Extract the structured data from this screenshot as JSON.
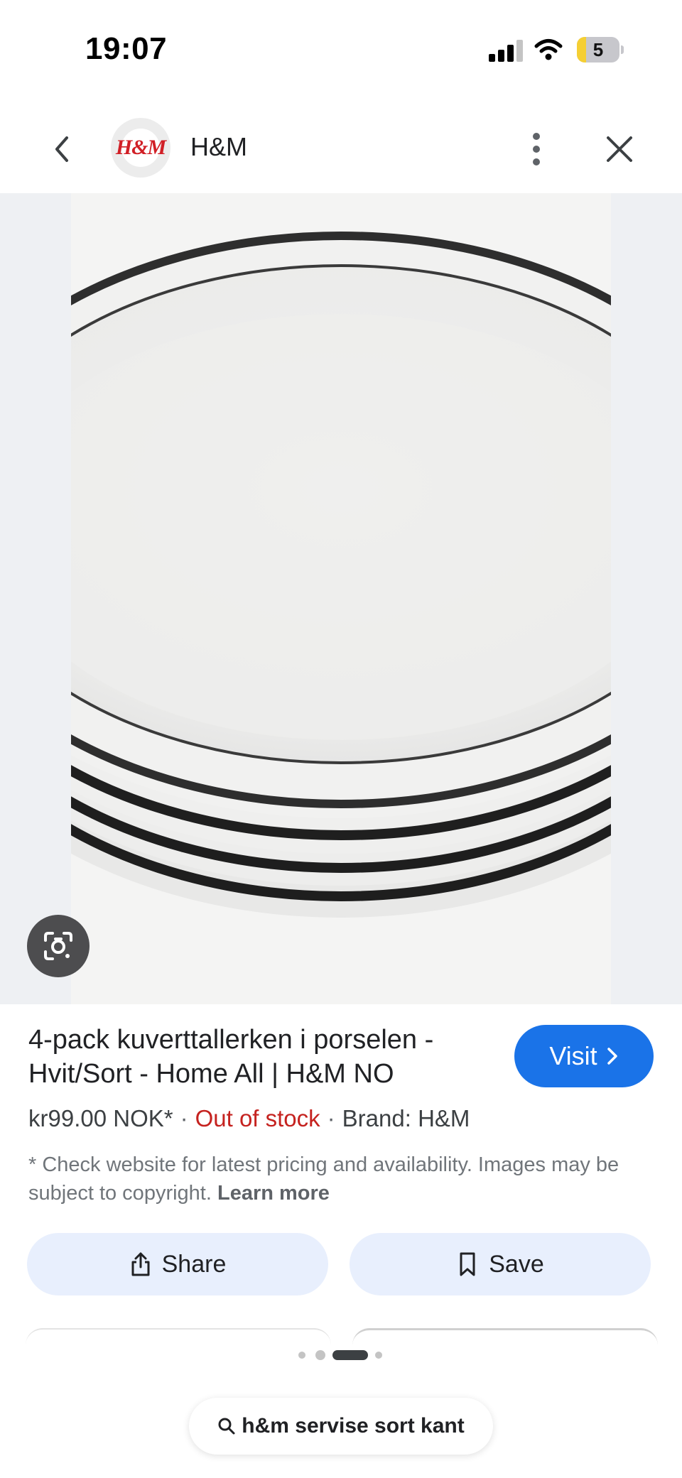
{
  "status_bar": {
    "time": "19:07",
    "battery": "5"
  },
  "header": {
    "brand_name": "H&M",
    "logo_text": "H&M"
  },
  "product": {
    "title": "4-pack kuverttallerken i porselen - Hvit/Sort - Home All | H&M NO",
    "price": "kr99.00 NOK*",
    "separator": "·",
    "stock_status": "Out of stock",
    "brand": "Brand: H&M",
    "disclaimer": "* Check website for latest pricing and availability. Images may be subject to copyright.",
    "learn_more": "Learn more"
  },
  "buttons": {
    "visit": "Visit",
    "share": "Share",
    "save": "Save"
  },
  "pager": {
    "count": 4,
    "active_index": 2
  },
  "search": {
    "query": "h&m servise sort kant"
  },
  "colors": {
    "accent": "#1a73e8",
    "out_of_stock": "#c5221f",
    "action_bg": "#e8effd",
    "brand_red": "#d11f26"
  },
  "icons": {
    "back": "chevron-left-icon",
    "more": "more-vertical-icon",
    "close": "close-icon",
    "lens": "google-lens-icon",
    "share": "share-icon",
    "save": "bookmark-icon",
    "search": "search-icon"
  }
}
